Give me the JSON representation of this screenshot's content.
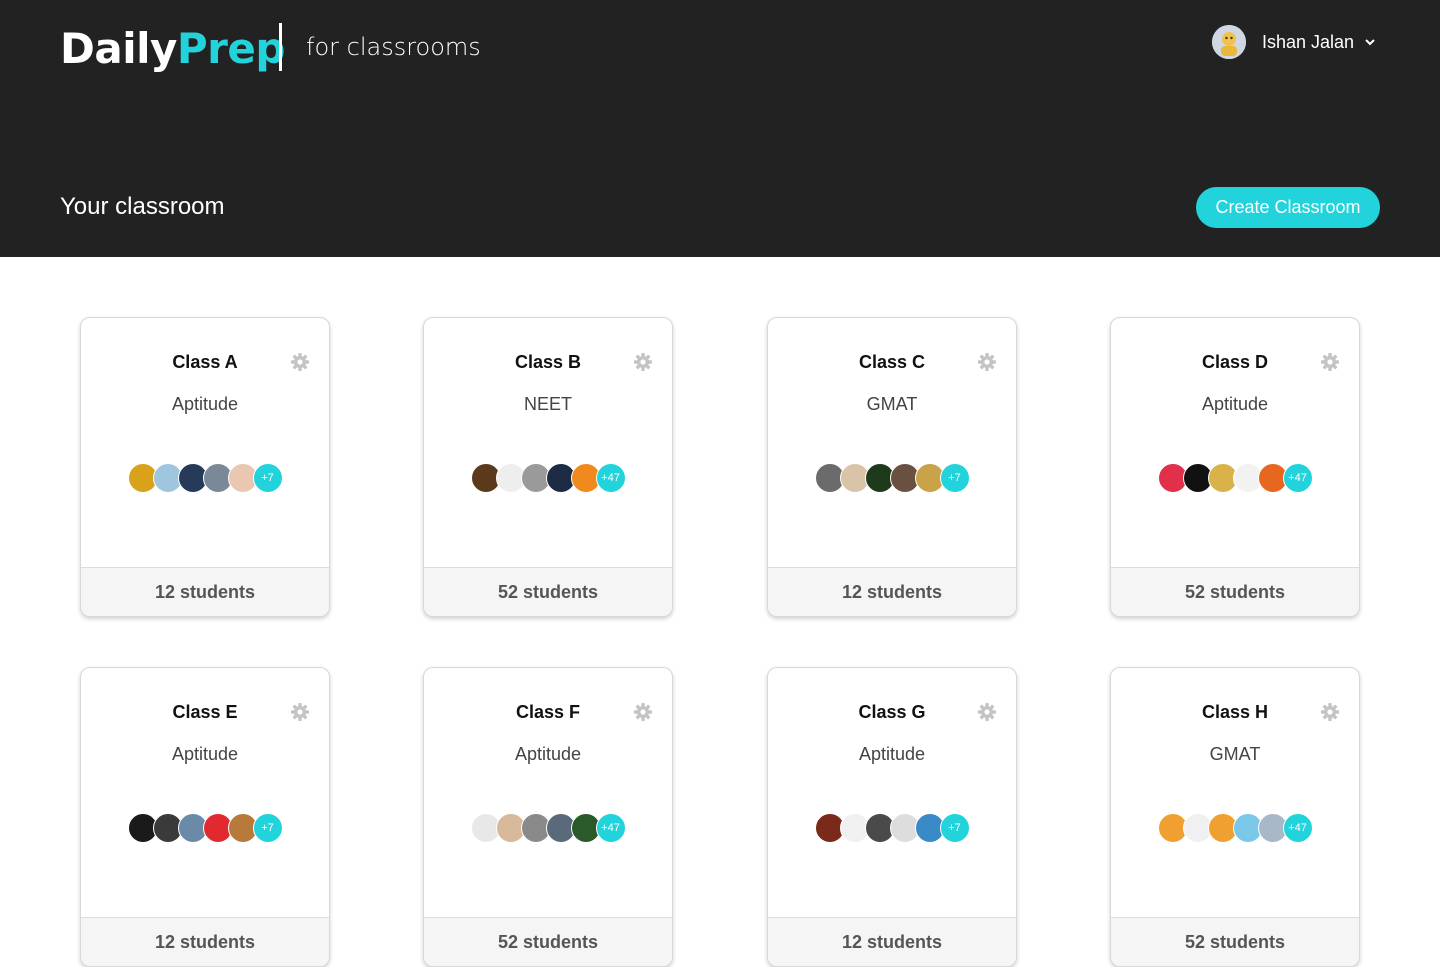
{
  "brand": {
    "daily": "Daily",
    "prep": "Prep",
    "subtitle": "for classrooms",
    "accent": "#22d3db",
    "header_bg": "#222222"
  },
  "user": {
    "name": "Ishan Jalan",
    "avatar_icon": "user-avatar-icon",
    "caret_icon": "chevron-down-icon"
  },
  "page": {
    "title": "Your classroom",
    "create_label": "Create Classroom"
  },
  "classes": [
    {
      "name": "Class A",
      "subject": "Aptitude",
      "students": "12 students",
      "more": "+7",
      "avatar_colors": [
        "#d9a21b",
        "#9fc6de",
        "#263a5a",
        "#7a8898",
        "#e9c7b1"
      ]
    },
    {
      "name": "Class B",
      "subject": "NEET",
      "students": "52 students",
      "more": "+47",
      "avatar_colors": [
        "#5a3a1a",
        "#eeeeee",
        "#9a9a9a",
        "#1e2b45",
        "#f08a1c"
      ]
    },
    {
      "name": "Class C",
      "subject": "GMAT",
      "students": "12 students",
      "more": "+7",
      "avatar_colors": [
        "#6b6b6b",
        "#d9c4a8",
        "#1f3a1a",
        "#6a5040",
        "#c9a24a"
      ]
    },
    {
      "name": "Class D",
      "subject": "Aptitude",
      "students": "52 students",
      "more": "+47",
      "avatar_colors": [
        "#e0304a",
        "#111111",
        "#d9b34a",
        "#f2f2f2",
        "#e8671f"
      ]
    },
    {
      "name": "Class E",
      "subject": "Aptitude",
      "students": "12 students",
      "more": "+7",
      "avatar_colors": [
        "#1a1a1a",
        "#3a3a3a",
        "#6a8aa8",
        "#e02a30",
        "#b87a3a"
      ]
    },
    {
      "name": "Class F",
      "subject": "Aptitude",
      "students": "52 students",
      "more": "+47",
      "avatar_colors": [
        "#e8e8e8",
        "#d8b89a",
        "#8a8a8a",
        "#5a6a7a",
        "#2a5a2a"
      ]
    },
    {
      "name": "Class G",
      "subject": "Aptitude",
      "students": "12 students",
      "more": "+7",
      "avatar_colors": [
        "#7a2a1a",
        "#f0f0f0",
        "#4a4a4a",
        "#dddddd",
        "#3a8ac8"
      ]
    },
    {
      "name": "Class H",
      "subject": "GMAT",
      "students": "52 students",
      "more": "+47",
      "avatar_colors": [
        "#f0a030",
        "#f0f0f0",
        "#f0a030",
        "#7ac8e8",
        "#a8b8c8"
      ]
    }
  ]
}
